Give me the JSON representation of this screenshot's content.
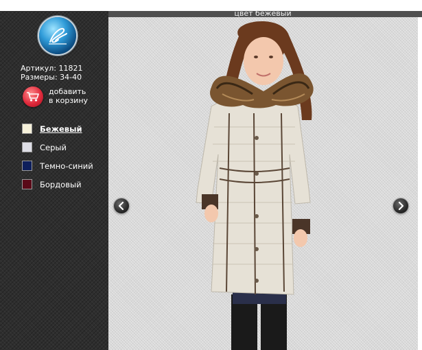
{
  "caption": "цвет бежевый",
  "product": {
    "article": "Артикул: 11821",
    "sizes": "Размеры: 34-40"
  },
  "cart": {
    "line1": "добавить",
    "line2": "в корзину",
    "icon": "shopping-cart-icon"
  },
  "colors": [
    {
      "label": "Бежевый",
      "swatch": "#f6f1da",
      "selected": true
    },
    {
      "label": "Серый",
      "swatch": "#dedee6",
      "selected": false
    },
    {
      "label": "Темно-синий",
      "swatch": "#0e1f5c",
      "selected": false
    },
    {
      "label": "Бордовый",
      "swatch": "#5a0a18",
      "selected": false
    }
  ],
  "nav": {
    "prev_icon": "chevron-left-icon",
    "next_icon": "chevron-right-icon"
  },
  "logo_icon": "brand-logo-icon"
}
